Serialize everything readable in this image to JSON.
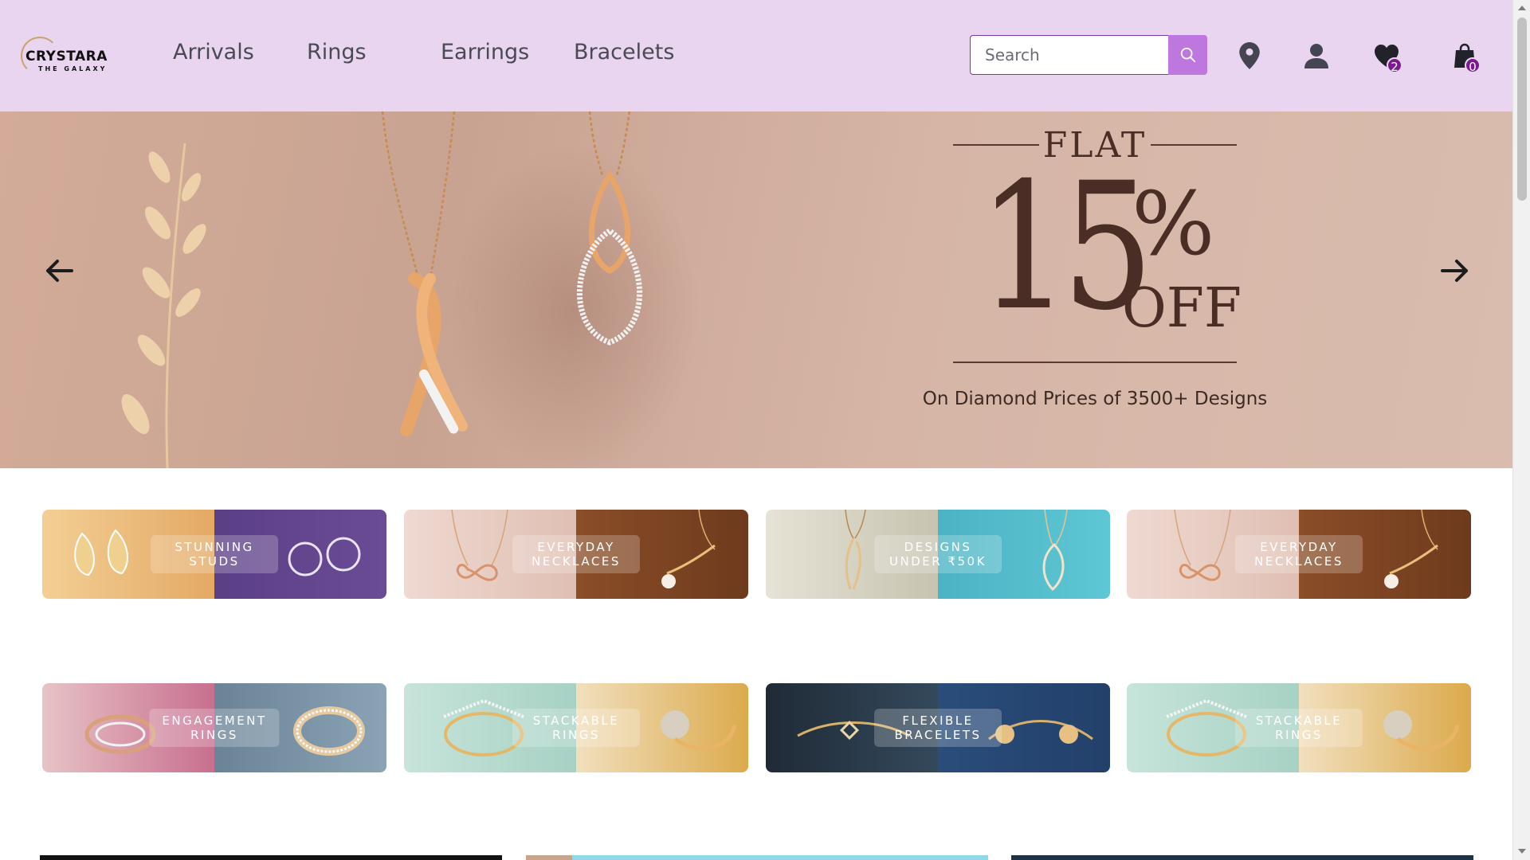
{
  "brand": {
    "name": "CRYSTARA",
    "tagline": "THE GALAXY"
  },
  "nav": {
    "items": [
      "Arrivals",
      "Rings",
      "Earrings",
      "Bracelets"
    ]
  },
  "search": {
    "placeholder": "Search"
  },
  "header_icons": {
    "search_button": "search-icon",
    "location": "map-pin-icon",
    "account": "user-icon",
    "wishlist": "heart-icon",
    "wishlist_count": "2",
    "cart": "shopping-bag-icon",
    "cart_count": "0"
  },
  "hero": {
    "flat": "FLAT",
    "amount": "15",
    "percent": "%",
    "off": "OFF",
    "subtitle": "On Diamond Prices of 3500+ Designs",
    "prev_icon": "arrow-left-icon",
    "next_icon": "arrow-right-icon"
  },
  "categories": {
    "row1": [
      {
        "label": "STUNNING\nSTUDS",
        "left_color": "#e9b97a",
        "right_color": "#5b3f86"
      },
      {
        "label": "EVERYDAY\nNECKLACES",
        "left_color": "#e7cbc2",
        "right_color": "#7a4423"
      },
      {
        "label": "DESIGNS\nUNDER ₹50K",
        "left_color": "#d8d6c6",
        "right_color": "#4fb9c8"
      },
      {
        "label": "EVERYDAY\nNECKLACES",
        "left_color": "#e7cbc2",
        "right_color": "#7a4423"
      }
    ],
    "row2": [
      {
        "label": "ENGAGEMENT\nRINGS",
        "left_color": "#d59ba8",
        "right_color": "#6f8aa0"
      },
      {
        "label": "STACKABLE\nRINGS",
        "left_color": "#b9dcd2",
        "right_color": "#e0b560"
      },
      {
        "label": "FLEXIBLE\nBRACELETS",
        "left_color": "#2a3c4e",
        "right_color": "#274673"
      },
      {
        "label": "STACKABLE\nRINGS",
        "left_color": "#b9dcd2",
        "right_color": "#e0b560"
      }
    ]
  }
}
